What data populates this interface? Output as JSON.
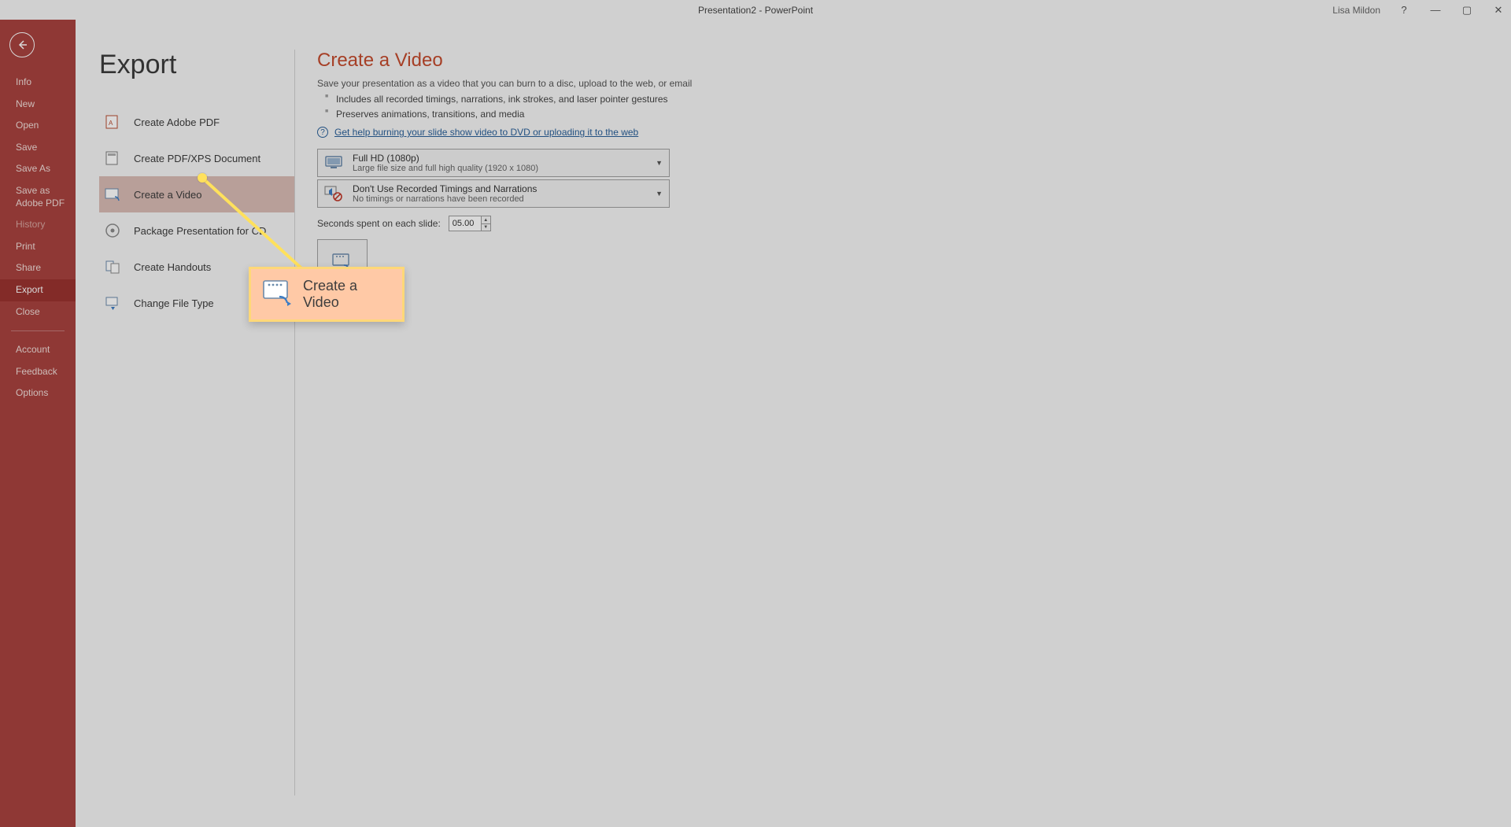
{
  "title": "Presentation2  -  PowerPoint",
  "user": "Lisa Mildon",
  "sidebar": {
    "items": [
      {
        "label": "Info"
      },
      {
        "label": "New"
      },
      {
        "label": "Open"
      },
      {
        "label": "Save"
      },
      {
        "label": "Save As"
      },
      {
        "label": "Save as Adobe PDF"
      },
      {
        "label": "History",
        "muted": true
      },
      {
        "label": "Print"
      },
      {
        "label": "Share"
      },
      {
        "label": "Export",
        "selected": true
      },
      {
        "label": "Close"
      }
    ],
    "footer": [
      {
        "label": "Account"
      },
      {
        "label": "Feedback"
      },
      {
        "label": "Options"
      }
    ]
  },
  "pageTitle": "Export",
  "exportOptions": [
    {
      "label": "Create Adobe PDF"
    },
    {
      "label": "Create PDF/XPS Document"
    },
    {
      "label": "Create a Video",
      "selected": true
    },
    {
      "label": "Package Presentation for CD"
    },
    {
      "label": "Create Handouts"
    },
    {
      "label": "Change File Type"
    }
  ],
  "video": {
    "heading": "Create a Video",
    "desc": "Save your presentation as a video that you can burn to a disc, upload to the web, or email",
    "b1": "Includes all recorded timings, narrations, ink strokes, and laser pointer gestures",
    "b2": "Preserves animations, transitions, and media",
    "helpText": "Get help burning your slide show video to DVD or uploading it to the web",
    "quality": {
      "title": "Full HD (1080p)",
      "sub": "Large file size and full high quality (1920 x 1080)"
    },
    "timings": {
      "title": "Don't Use Recorded Timings and Narrations",
      "sub": "No timings or narrations have been recorded"
    },
    "secondsLabel": "Seconds spent on each slide:",
    "secondsValue": "05.00"
  },
  "callout": {
    "label": "Create a Video"
  }
}
